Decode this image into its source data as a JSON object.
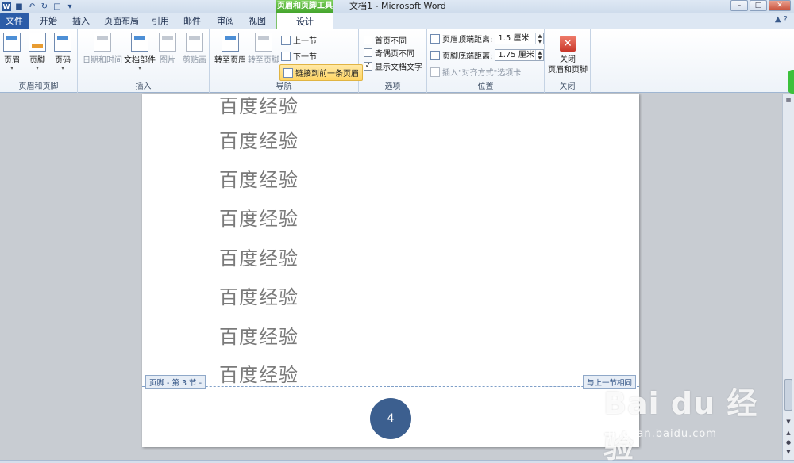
{
  "window": {
    "title": "文档1 - Microsoft Word",
    "context_tools": "页眉和页脚工具"
  },
  "tabs": [
    "文件",
    "开始",
    "插入",
    "页面布局",
    "引用",
    "邮件",
    "审阅",
    "视图",
    "设计"
  ],
  "ribbon": {
    "header_footer_group": {
      "label": "页眉和页脚",
      "buttons": [
        "页眉",
        "页脚",
        "页码"
      ]
    },
    "insert_group": {
      "label": "插入",
      "buttons": [
        "日期和时间",
        "文档部件",
        "图片",
        "剪贴画"
      ]
    },
    "nav_group": {
      "label": "导航",
      "goto_header": "转至页眉",
      "goto_footer": "转至页脚",
      "prev_section": "上一节",
      "next_section": "下一节",
      "link_prev": "链接到前一条页眉"
    },
    "options_group": {
      "label": "选项",
      "diff_first": "首页不同",
      "diff_odd_even": "奇偶页不同",
      "show_doc_text": "显示文档文字",
      "show_doc_text_checked": "✓"
    },
    "position_group": {
      "label": "位置",
      "header_top_label": "页眉顶端距离:",
      "header_top_value": "1.5 厘米",
      "footer_bottom_label": "页脚底端距离:",
      "footer_bottom_value": "1.75 厘米",
      "insert_align_tab": "插入\"对齐方式\"选项卡"
    },
    "close_group": {
      "label": "关闭",
      "close_button": "关闭\n页眉和页脚"
    }
  },
  "document": {
    "lines": [
      "百度经验",
      "百度经验",
      "百度经验",
      "百度经验",
      "百度经验",
      "百度经验",
      "百度经验",
      "百度经验"
    ],
    "footer_label": "页脚 - 第 3 节 -",
    "same_as_prev": "与上一节相同",
    "page_number": "4"
  },
  "watermark": {
    "logo": "Bai du 经验",
    "url": "jingyan.baidu.com"
  }
}
